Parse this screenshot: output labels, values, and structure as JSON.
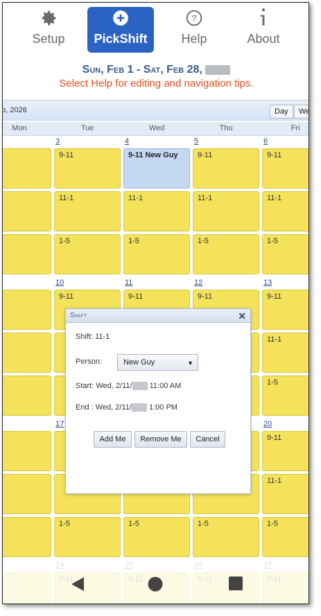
{
  "nav": {
    "setup": "Setup",
    "pickshift": "PickShift",
    "help": "Help",
    "about": "About"
  },
  "header": {
    "range": "Sun, Feb 1 - Sat, Feb 28,",
    "tip": "Select Help for editing and navigation tips."
  },
  "toolbar": {
    "month": "b, 2026",
    "day_button": "Day",
    "week_button": "We"
  },
  "days": [
    "Mon",
    "Tue",
    "Wed",
    "Thu",
    "Fri"
  ],
  "weeks": [
    {
      "dates": [
        "",
        "3",
        "4",
        "5",
        "6"
      ]
    },
    {
      "dates": [
        "",
        "10",
        "11",
        "12",
        "13"
      ]
    },
    {
      "dates": [
        "",
        "17",
        "",
        "",
        "20"
      ]
    },
    {
      "dates": [
        "",
        "24",
        "25",
        "26",
        "27"
      ]
    }
  ],
  "slots": [
    "9-11",
    "11-1",
    "1-5"
  ],
  "selected_cell": "9-11 New Guy",
  "dialog": {
    "title": "Shift",
    "close": "✕",
    "shift": "Shift: 11-1",
    "person_label": "Person:",
    "person_value": "New Guy",
    "start_label": "Start:",
    "start_prefix": "Wed, 2/11/",
    "start_suffix": "11:00 AM",
    "end_label": "End :",
    "end_prefix": "Wed, 2/11/",
    "end_suffix": "1:00 PM",
    "add": "Add Me",
    "remove": "Remove Me",
    "cancel": "Cancel"
  },
  "colors": {
    "accent": "#2a63c2",
    "shift_yellow": "#f3e25a",
    "selected_blue": "#c5d8f2",
    "tip_orange": "#e0501d"
  }
}
